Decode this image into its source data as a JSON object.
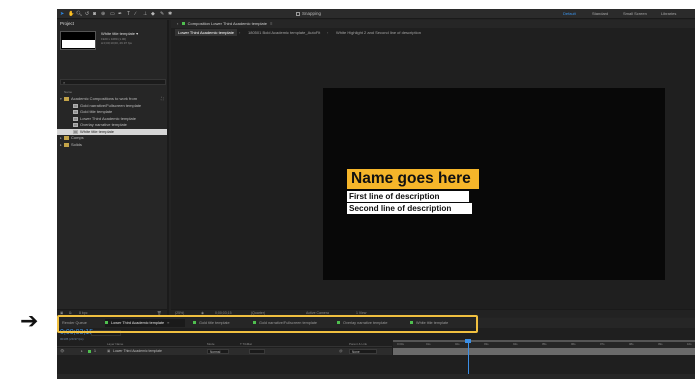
{
  "colors": {
    "accent": "#2d8ceb",
    "highlight": "#f0c040",
    "name_bar": "#f5b52a"
  },
  "toolbar": {
    "tools": [
      "selection-tool-icon",
      "hand-tool-icon",
      "zoom-tool-icon",
      "rotate-tool-icon",
      "camera-tool-icon",
      "pan-behind-tool-icon",
      "mask-tool-icon",
      "pen-tool-icon",
      "type-tool-icon",
      "brush-tool-icon",
      "clone-stamp-tool-icon",
      "eraser-tool-icon",
      "roto-brush-tool-icon",
      "puppet-tool-icon"
    ],
    "snapping_label": "Snapping",
    "workspaces": [
      "Default",
      "Standard",
      "Small Screen",
      "Libraries"
    ]
  },
  "project": {
    "tab_label": "Project",
    "item_name": "White title template ▾",
    "item_meta": [
      "1920 x 1080 (1.00)",
      "Δ 0;00;10;00, 29.97 fps"
    ],
    "column_name": "Name",
    "tree": [
      {
        "label": "Academic Compositions to work from",
        "kind": "folder",
        "indent": 0,
        "expanded": true
      },
      {
        "label": "Gold narrative/Fullscreen template",
        "kind": "comp",
        "indent": 1
      },
      {
        "label": "Gold title template",
        "kind": "comp",
        "indent": 1
      },
      {
        "label": "Lower Third Academic template",
        "kind": "comp",
        "indent": 1
      },
      {
        "label": "Overlay narrative template",
        "kind": "comp",
        "indent": 1
      },
      {
        "label": "White title template",
        "kind": "comp",
        "indent": 1,
        "selected": true
      },
      {
        "label": "Comps",
        "kind": "folder",
        "indent": 0
      },
      {
        "label": "Solids",
        "kind": "folder",
        "indent": 0
      }
    ],
    "footer_depth": "8 bpc"
  },
  "composition": {
    "tab_label": "Composition Lower Third Academic template",
    "breadcrumbs": [
      "Lower Third Academic template",
      "180501 Bold Academic template_AutoFit",
      "White Highlight 2 and Second line of description"
    ],
    "name_text": "Name goes here",
    "desc_line1": "First line of description",
    "desc_line2": "Second line of description",
    "footer": {
      "zoom": "(25%)",
      "timecode": "0;00;03;15",
      "resolution": "(Quarter)",
      "camera": "Active Camera",
      "views": "1 View"
    }
  },
  "timeline": {
    "tabs": [
      {
        "label": "Render Queue",
        "color": ""
      },
      {
        "label": "Lower Third Academic template",
        "color": "#4fbf4f",
        "active": true
      },
      {
        "label": "Gold title template",
        "color": "#4fbf4f"
      },
      {
        "label": "Gold narrative/Fullscreen template",
        "color": "#4fbf4f"
      },
      {
        "label": "Overlay narrative template",
        "color": "#4fbf4f"
      },
      {
        "label": "White title template",
        "color": "#4fbf4f"
      }
    ],
    "time": "0;00;03;15",
    "fps": "00105 (29.97 fps)",
    "columns": {
      "layer_name": "Layer Name",
      "mode": "Mode",
      "trkmat": "T TrkMat",
      "parent": "Parent & Link"
    },
    "layer": {
      "index": "1",
      "name": "Lower Third Academic template",
      "mode": "Normal",
      "parent": "None"
    },
    "ticks": [
      "0:00s",
      "01s",
      "02s",
      "03s",
      "04s",
      "05s",
      "06s",
      "07s",
      "08s",
      "09s",
      "10s"
    ]
  }
}
